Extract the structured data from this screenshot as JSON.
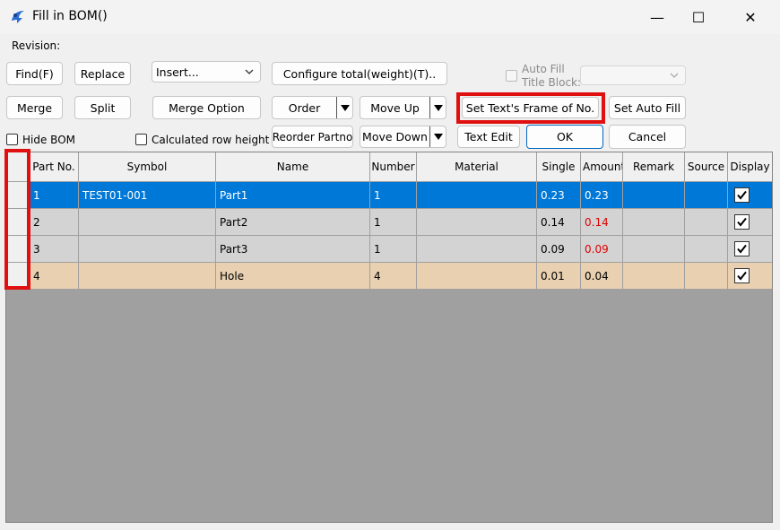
{
  "window": {
    "title": "Fill in BOM()",
    "minimize": "—",
    "maximize": "☐",
    "close": "✕"
  },
  "labels": {
    "revision": "Revision:",
    "auto_fill": "Auto Fill",
    "title_block": "Title Block:"
  },
  "buttons": {
    "find": "Find(F)",
    "replace": "Replace",
    "configure_total": "Configure total(weight)(T)..",
    "merge": "Merge",
    "split": "Split",
    "merge_option": "Merge Option",
    "order": "Order",
    "move_up": "Move Up",
    "set_text_frame": "Set Text's Frame of No.",
    "set_auto_fill": "Set Auto Fill",
    "reorder_partno": "Reorder Partno",
    "move_down": "Move Down",
    "text_edit": "Text Edit",
    "ok": "OK",
    "cancel": "Cancel"
  },
  "combos": {
    "insert": "Insert...",
    "title_block": ""
  },
  "checkboxes": {
    "hide_bom": {
      "label": "Hide BOM",
      "checked": false
    },
    "calculated_row_height": {
      "label": "Calculated row height",
      "checked": false
    },
    "auto_fill_title_block": {
      "checked": false,
      "disabled": true
    }
  },
  "table": {
    "columns": [
      "",
      "Part No.",
      "Symbol",
      "Name",
      "Number",
      "Material",
      "Single",
      "Amount",
      "Remark",
      "Source",
      "Display"
    ],
    "rows": [
      {
        "cells": [
          "",
          "1",
          "TEST01-001",
          "Part1",
          "1",
          "",
          "0.23",
          "0.23",
          "",
          ""
        ],
        "display": true,
        "state": "selected"
      },
      {
        "cells": [
          "",
          "2",
          "",
          "Part2",
          "1",
          "",
          "0.14",
          "0.14",
          "",
          ""
        ],
        "display": true,
        "state": "normal"
      },
      {
        "cells": [
          "",
          "3",
          "",
          "Part3",
          "1",
          "",
          "0.09",
          "0.09",
          "",
          ""
        ],
        "display": true,
        "state": "normal"
      },
      {
        "cells": [
          "",
          "4",
          "",
          "Hole",
          "4",
          "",
          "0.01",
          "0.04",
          "",
          ""
        ],
        "display": true,
        "state": "highlight"
      }
    ]
  },
  "colors": {
    "selected_row": "#0078d7",
    "normal_row": "#d3d3d3",
    "highlight_row": "#e8d0b0",
    "amount_red": "#e00000",
    "annotation": "#e01010",
    "grid_background": "#a0a0a0"
  },
  "icons": {
    "app": "bom-app-icon",
    "dropdown": "chevron-down-icon",
    "split_arrow": "triangle-down-icon",
    "check": "checkmark-icon"
  }
}
